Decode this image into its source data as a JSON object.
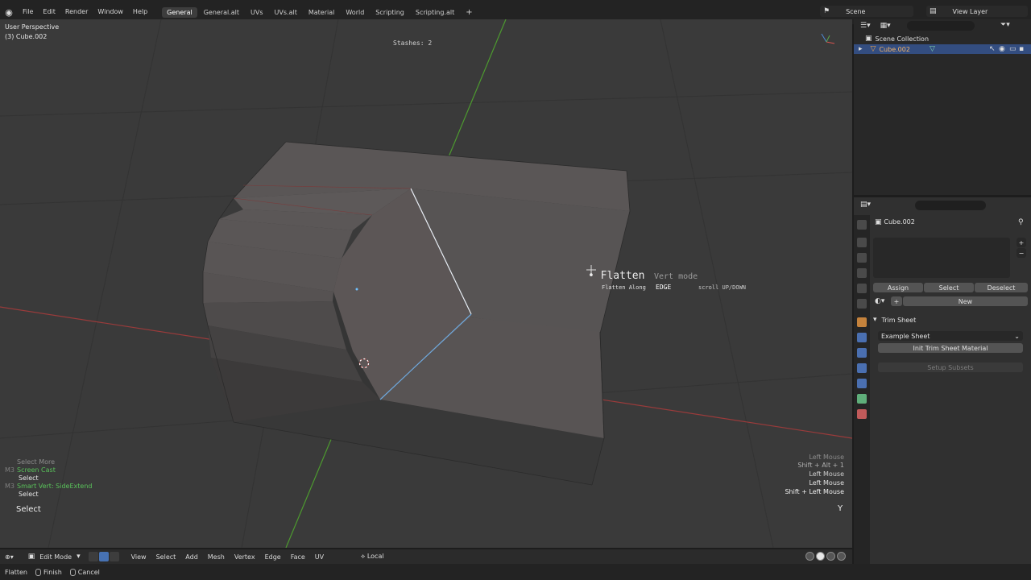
{
  "menubar": {
    "items": [
      "File",
      "Edit",
      "Render",
      "Window",
      "Help"
    ],
    "workspaces": [
      "General",
      "General.alt",
      "UVs",
      "UVs.alt",
      "Material",
      "World",
      "Scripting",
      "Scripting.alt"
    ],
    "active_workspace": "General",
    "add_symbol": "+",
    "scene": "Scene",
    "view_layer": "View Layer"
  },
  "viewport": {
    "perspective": "User Perspective",
    "object_info": "(3) Cube.002",
    "stashes": "Stashes: 2",
    "hud": {
      "bullet": "•",
      "title": "Flatten",
      "mode": "Vert mode",
      "along_label": "Flatten Along",
      "along_value": "EDGE",
      "scroll_hint": "scroll UP/DOWN"
    },
    "keylog": [
      {
        "mod": "",
        "text": "Select More",
        "style": "dim"
      },
      {
        "mod": "M3",
        "text": "Screen Cast",
        "style": "grn"
      },
      {
        "mod": "",
        "text": "Select",
        "style": "wht"
      },
      {
        "mod": "M3",
        "text": "Smart Vert: SideExtend",
        "style": "grn"
      },
      {
        "mod": "",
        "text": "Select",
        "style": "wht"
      }
    ],
    "keylog_last": "Select",
    "mouselog": [
      "Left Mouse",
      "Shift + Alt + 1",
      "Left Mouse",
      "Left Mouse",
      "Shift + Left Mouse"
    ],
    "last_key": "Y"
  },
  "viewport_footer": {
    "mode": "Edit Mode",
    "menus": [
      "View",
      "Select",
      "Add",
      "Mesh",
      "Vertex",
      "Edge",
      "Face",
      "UV"
    ],
    "transform_orientation": "Local"
  },
  "statusbar": {
    "items": [
      "Flatten",
      "Finish",
      "Cancel"
    ]
  },
  "outliner": {
    "scene_collection": "Scene Collection",
    "object": "Cube.002"
  },
  "properties": {
    "object": "Cube.002",
    "buttons": {
      "assign": "Assign",
      "select": "Select",
      "deselect": "Deselect",
      "add": "+",
      "new": "New"
    },
    "panel_title": "Trim Sheet",
    "sheet": "Example Sheet",
    "init_button": "Init Trim Sheet Material",
    "setup_button": "Setup Subsets"
  },
  "colors": {
    "viewport_bg": "#3a3a3a",
    "selection_blue": "#334d80",
    "keylog_green": "#59c25a",
    "x_axis": "#9a3b3b",
    "y_axis": "#4d9a2f"
  }
}
